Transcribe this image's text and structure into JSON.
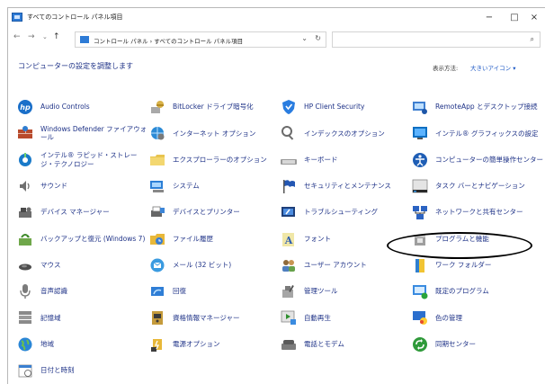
{
  "window": {
    "title": "すべてのコントロール パネル項目",
    "minimize": "−",
    "maximize": "□",
    "close": "×"
  },
  "nav": {
    "back": "←",
    "forward": "→",
    "recent": "⌄",
    "up": "↑",
    "address": "コントロール パネル › すべてのコントロール パネル項目",
    "dropdown": "⌄",
    "refresh": "↻",
    "search_placeholder": ""
  },
  "header": {
    "title": "コンピューターの設定を調整します",
    "view_by_label": "表示方法:",
    "view_by_value": "大きいアイコン ▾"
  },
  "items": [
    {
      "label": "Audio Controls",
      "icon": "hp-icon"
    },
    {
      "label": "BitLocker ドライブ暗号化",
      "icon": "bitlocker-key-icon"
    },
    {
      "label": "HP Client Security",
      "icon": "hp-shield-icon"
    },
    {
      "label": "RemoteApp とデスクトップ接続",
      "icon": "remoteapp-icon"
    },
    {
      "label": "Windows Defender ファイアウォール",
      "icon": "firewall-icon"
    },
    {
      "label": "インターネット オプション",
      "icon": "internet-options-icon"
    },
    {
      "label": "インデックスのオプション",
      "icon": "indexing-icon"
    },
    {
      "label": "インテル® グラフィックスの設定",
      "icon": "intel-graphics-icon"
    },
    {
      "label": "インテル® ラピッド・ストレージ・テクノロジー",
      "icon": "intel-rst-icon"
    },
    {
      "label": "エクスプローラーのオプション",
      "icon": "folder-options-icon"
    },
    {
      "label": "キーボード",
      "icon": "keyboard-icon"
    },
    {
      "label": "コンピューターの簡単操作センター",
      "icon": "ease-of-access-icon"
    },
    {
      "label": "サウンド",
      "icon": "speaker-icon"
    },
    {
      "label": "システム",
      "icon": "system-icon"
    },
    {
      "label": "セキュリティとメンテナンス",
      "icon": "security-flag-icon"
    },
    {
      "label": "タスク バーとナビゲーション",
      "icon": "taskbar-icon"
    },
    {
      "label": "デバイス マネージャー",
      "icon": "device-manager-icon"
    },
    {
      "label": "デバイスとプリンター",
      "icon": "printer-icon"
    },
    {
      "label": "トラブルシューティング",
      "icon": "troubleshoot-icon"
    },
    {
      "label": "ネットワークと共有センター",
      "icon": "network-icon"
    },
    {
      "label": "バックアップと復元 (Windows 7)",
      "icon": "backup-icon"
    },
    {
      "label": "ファイル履歴",
      "icon": "file-history-icon"
    },
    {
      "label": "フォント",
      "icon": "font-icon"
    },
    {
      "label": "プログラムと機能",
      "icon": "programs-icon"
    },
    {
      "label": "マウス",
      "icon": "mouse-icon"
    },
    {
      "label": "メール (32 ビット)",
      "icon": "mail-icon"
    },
    {
      "label": "ユーザー アカウント",
      "icon": "user-accounts-icon"
    },
    {
      "label": "ワーク フォルダー",
      "icon": "work-folders-icon"
    },
    {
      "label": "音声認識",
      "icon": "microphone-icon"
    },
    {
      "label": "回復",
      "icon": "recovery-icon"
    },
    {
      "label": "管理ツール",
      "icon": "admin-tools-icon"
    },
    {
      "label": "既定のプログラム",
      "icon": "default-programs-icon"
    },
    {
      "label": "記憶域",
      "icon": "storage-icon"
    },
    {
      "label": "資格情報マネージャー",
      "icon": "credential-icon"
    },
    {
      "label": "自動再生",
      "icon": "autoplay-icon"
    },
    {
      "label": "色の管理",
      "icon": "color-management-icon"
    },
    {
      "label": "地域",
      "icon": "region-globe-icon"
    },
    {
      "label": "電源オプション",
      "icon": "power-icon"
    },
    {
      "label": "電話とモデム",
      "icon": "phone-modem-icon"
    },
    {
      "label": "同期センター",
      "icon": "sync-icon"
    },
    {
      "label": "日付と時刻",
      "icon": "clock-icon"
    }
  ]
}
